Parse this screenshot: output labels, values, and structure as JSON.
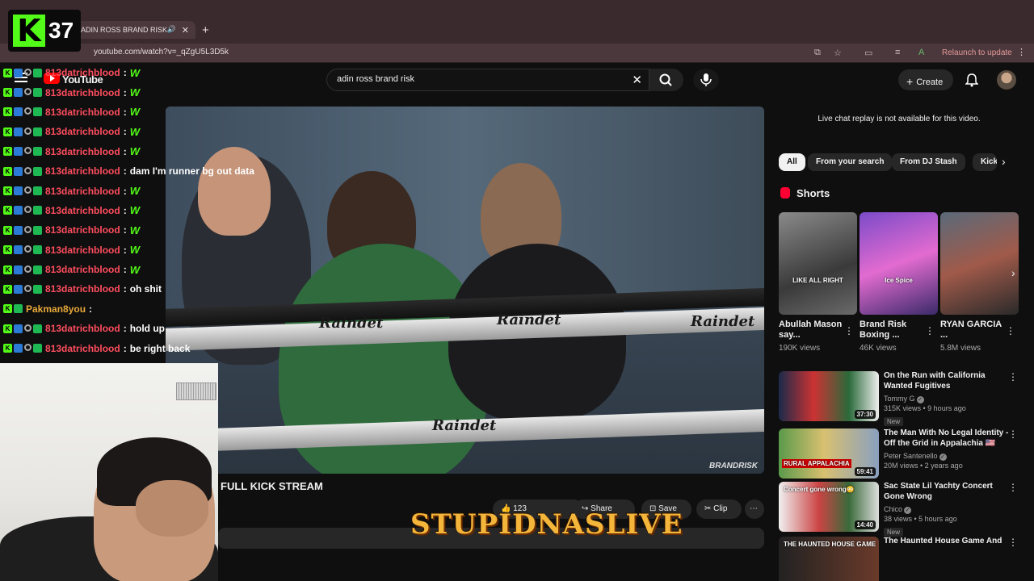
{
  "browser": {
    "tab_title": "ADIN ROSS BRAND RISK",
    "url": "youtube.com/watch?v=_qZgU5L3D5k",
    "relaunch_label": "Relaunch to update"
  },
  "kick_counter": {
    "logo": "K",
    "count": "37"
  },
  "youtube": {
    "logo_text": "YouTube",
    "search_value": "adin ross brand risk",
    "create_label": "Create"
  },
  "chat": [
    {
      "user": "813datrichblood",
      "msg": "W",
      "style": "w"
    },
    {
      "user": "813datrichblood",
      "msg": "W",
      "style": "w"
    },
    {
      "user": "813datrichblood",
      "msg": "W",
      "style": "w"
    },
    {
      "user": "813datrichblood",
      "msg": "W",
      "style": "w"
    },
    {
      "user": "813datrichblood",
      "msg": "W",
      "style": "w"
    },
    {
      "user": "813datrichblood",
      "msg": "dam I'm runner bg out data",
      "style": "text"
    },
    {
      "user": "813datrichblood",
      "msg": "W",
      "style": "w"
    },
    {
      "user": "813datrichblood",
      "msg": "W",
      "style": "w"
    },
    {
      "user": "813datrichblood",
      "msg": "W",
      "style": "w"
    },
    {
      "user": "813datrichblood",
      "msg": "W",
      "style": "w"
    },
    {
      "user": "813datrichblood",
      "msg": "W",
      "style": "w"
    },
    {
      "user": "813datrichblood",
      "msg": "oh shit",
      "style": "text"
    },
    {
      "user": "Pakman8you",
      "msg": "",
      "style": "text"
    },
    {
      "user": "813datrichblood",
      "msg": "hold up",
      "style": "text"
    },
    {
      "user": "813datrichblood",
      "msg": "be right back",
      "style": "text"
    }
  ],
  "video": {
    "rope_brand": "Raindet",
    "watermark": "BRANDRISK",
    "title": "FULL KICK STREAM",
    "like_count": "123",
    "share_label": "Share",
    "save_label": "Save",
    "clip_label": "Clip"
  },
  "overlay_logo": "STUPIDNASLIVE",
  "sidebar": {
    "live_chat_note": "Live chat replay is not available for this video.",
    "chips": [
      "All",
      "From your search",
      "From DJ Stash",
      "Kick"
    ],
    "shorts_heading": "Shorts",
    "shorts": [
      {
        "title": "Abullah Mason say...",
        "views": "190K views",
        "caption": "LIKE ALL RIGHT"
      },
      {
        "title": "Brand Risk Boxing ...",
        "views": "46K views",
        "caption": "Ice Spice"
      },
      {
        "title": "RYAN GARCIA ...",
        "views": "5.8M views",
        "caption": ""
      }
    ],
    "recommendations": [
      {
        "title": "On the Run with California Wanted Fugitives",
        "channel": "Tommy G",
        "meta": "315K views • 9 hours ago",
        "badge": "New",
        "duration": "37:30"
      },
      {
        "title": "The Man With No Legal Identity - Off the Grid in Appalachia 🇺🇸",
        "channel": "Peter Santenello",
        "meta": "20M views • 2 years ago",
        "badge": "",
        "duration": "59:41",
        "thumb_text": "RURAL APPALACHIA"
      },
      {
        "title": "Sac State Lil Yachty Concert Gone Wrong",
        "channel": "Chico",
        "meta": "38 views • 5 hours ago",
        "badge": "New",
        "duration": "14:40",
        "thumb_text": "Concert gone wrong😳"
      },
      {
        "title": "The Haunted House Game And",
        "channel": "",
        "meta": "",
        "badge": "",
        "duration": "",
        "thumb_text": "THE HAUNTED HOUSE GAME"
      }
    ]
  }
}
